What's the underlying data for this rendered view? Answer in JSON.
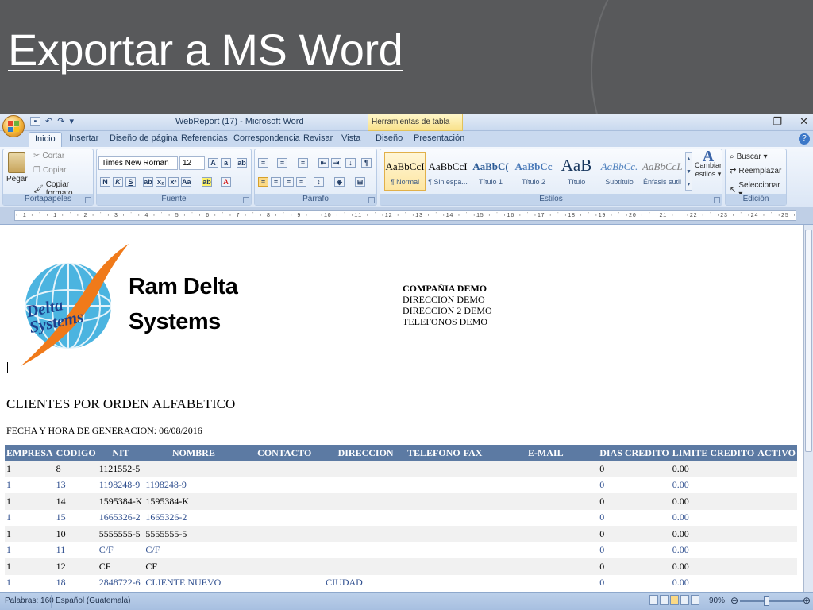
{
  "slide": {
    "title": "Exportar a MS Word"
  },
  "window": {
    "doc_title": "WebReport (17) - Microsoft Word",
    "context_tab": "Herramientas de tabla",
    "minimize": "–",
    "restore": "❐",
    "close": "✕"
  },
  "tabs": [
    "Inicio",
    "Insertar",
    "Diseño de página",
    "Referencias",
    "Correspondencia",
    "Revisar",
    "Vista",
    "Diseño",
    "Presentación"
  ],
  "ribbon": {
    "clipboard": {
      "paste": "Pegar",
      "cut": "Cortar",
      "copy": "Copiar",
      "format_painter": "Copiar formato",
      "label": "Portapapeles"
    },
    "font": {
      "name": "Times New Roman",
      "size": "12",
      "label": "Fuente"
    },
    "paragraph": {
      "label": "Párrafo"
    },
    "styles": {
      "label": "Estilos",
      "items": [
        {
          "sample": "AaBbCcI",
          "name": "¶ Normal"
        },
        {
          "sample": "AaBbCcI",
          "name": "¶ Sin espa..."
        },
        {
          "sample": "AaBbC(",
          "name": "Título 1"
        },
        {
          "sample": "AaBbCc",
          "name": "Título 2"
        },
        {
          "sample": "AaB",
          "name": "Título"
        },
        {
          "sample": "AaBbCc.",
          "name": "Subtítulo"
        },
        {
          "sample": "AaBbCcL",
          "name": "Énfasis sutil"
        }
      ],
      "change": "Cambiar",
      "change2": "estilos ▾"
    },
    "editing": {
      "find": "Buscar ▾",
      "replace": "Reemplazar",
      "select": "Seleccionar ▾",
      "label": "Edición"
    }
  },
  "ruler": "· 1 · ˙ · 1 · ˙ · 2 · ˙ · 3 · ˙ · 4 · ˙ · 5 · ˙ · 6 · ˙ · 7 · ˙ · 8 · ˙ · 9 · ˙ ·10 · ˙ ·11 · ˙ ·12 · ˙ ·13 · ˙ ·14 · ˙ ·15 · ˙ ·16 · ˙ ·17 · ˙ ·18 · ˙ ·19 · ˙ ·20 · ˙ ·21 · ˙ ·22 · ˙ ·23 · ˙ ·24 · ˙ ·25 · ˙ ·26 · ˙ ·27 · ˙ ·28 · ˙ ·29 · ˙ ·30 · ˙ ·31 · ˙ ·32 · ˙ ·33 · ˙ ·34 · ˙ ·35 · ˙ ·36 · ˙ ·37 · ˙ ·38 · ˙ ·39 · ˙",
  "document": {
    "logo_text": "Delta Systems",
    "company_line1": "Ram Delta",
    "company_line2": "Systems",
    "info": [
      "COMPAÑIA DEMO",
      "DIRECCION DEMO",
      "DIRECCION 2 DEMO",
      "TELEFONOS DEMO"
    ],
    "report_title": "CLIENTES POR ORDEN ALFABETICO",
    "report_date": "FECHA Y HORA DE GENERACION: 06/08/2016",
    "columns": [
      "EMPRESA",
      "CODIGO",
      "NIT",
      "NOMBRE",
      "CONTACTO",
      "DIRECCION",
      "TELEFONO",
      "FAX",
      "E-MAIL",
      "DIAS CREDITO",
      "LIMITE CREDITO",
      "ACTIVO"
    ],
    "rows": [
      [
        "1",
        "8",
        "1121552-5",
        "",
        "",
        "",
        "",
        "",
        "",
        "0",
        "0.00",
        ""
      ],
      [
        "1",
        "13",
        "1198248-9",
        "1198248-9",
        "",
        "",
        "",
        "",
        "",
        "0",
        "0.00",
        ""
      ],
      [
        "1",
        "14",
        "1595384-K",
        "1595384-K",
        "",
        "",
        "",
        "",
        "",
        "0",
        "0.00",
        ""
      ],
      [
        "1",
        "15",
        "1665326-2",
        "1665326-2",
        "",
        "",
        "",
        "",
        "",
        "0",
        "0.00",
        ""
      ],
      [
        "1",
        "10",
        "5555555-5",
        "5555555-5",
        "",
        "",
        "",
        "",
        "",
        "0",
        "0.00",
        ""
      ],
      [
        "1",
        "11",
        "C/F",
        "C/F",
        "",
        "",
        "",
        "",
        "",
        "0",
        "0.00",
        ""
      ],
      [
        "1",
        "12",
        "CF",
        "CF",
        "",
        "",
        "",
        "",
        "",
        "0",
        "0.00",
        ""
      ],
      [
        "1",
        "18",
        "2848722-6",
        "CLIENTE NUEVO",
        "",
        "CIUDAD",
        "",
        "",
        "",
        "0",
        "0.00",
        ""
      ]
    ]
  },
  "status": {
    "words": "Palabras: 160",
    "language": "Español (Guatemala)",
    "zoom": "90%"
  }
}
